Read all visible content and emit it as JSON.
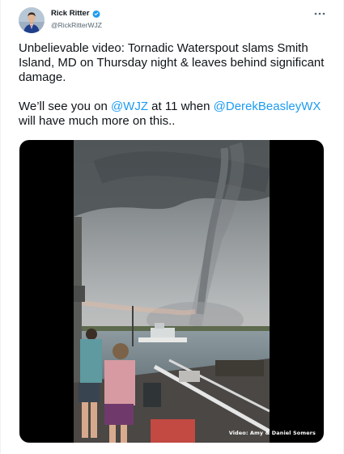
{
  "author": {
    "name": "Rick Ritter",
    "handle": "@RickRitterWJZ"
  },
  "tweet": {
    "line1": "Unbelievable video: Tornadic Waterspout slams Smith Island, MD on Thursday night & leaves behind significant damage.",
    "p2_a": "We’ll see you on ",
    "mention1": "@WJZ",
    "p2_b": " at 11 when ",
    "mention2": "@DerekBeasleyWX",
    "p2_c": " will have much more on this.."
  },
  "media": {
    "credit": "Video: Amy & Daniel Somers"
  },
  "icons": {
    "verified": "verified-badge-icon",
    "more": "more-options-icon"
  },
  "colors": {
    "accent": "#1d9bf0",
    "text": "#0f1419",
    "secondary": "#536471"
  }
}
